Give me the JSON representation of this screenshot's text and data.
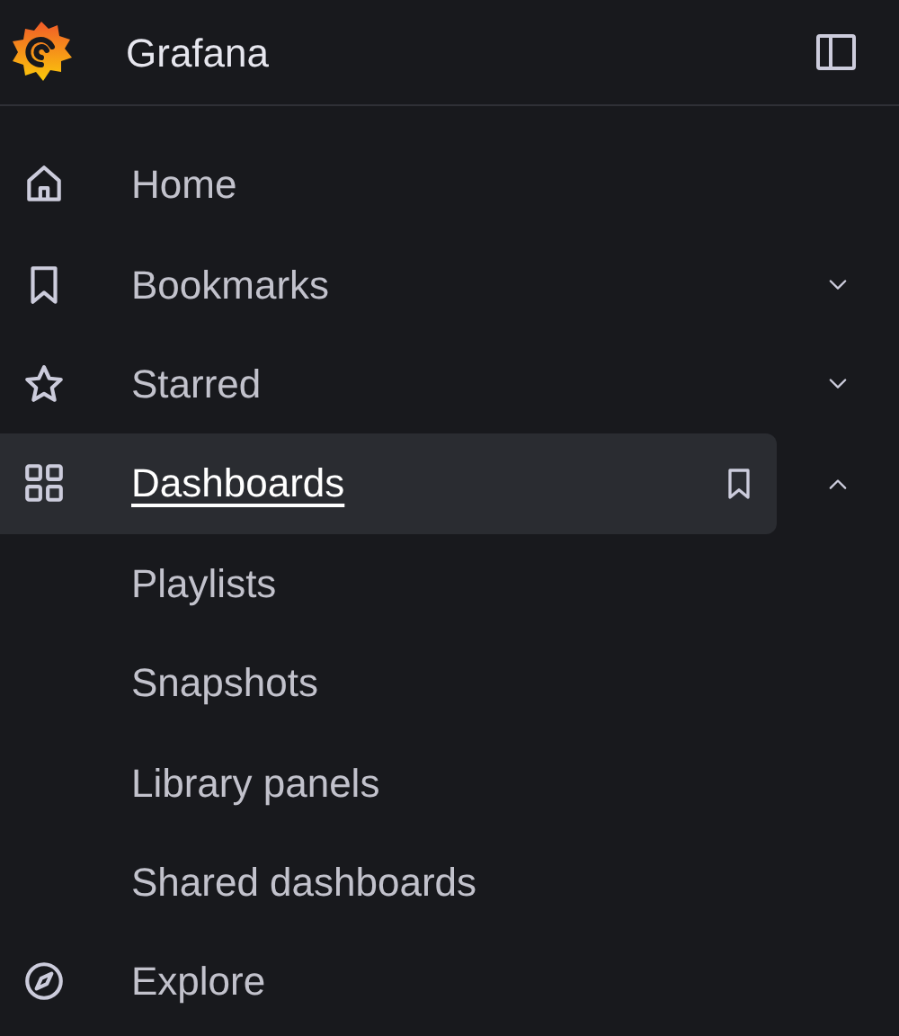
{
  "header": {
    "title": "Grafana"
  },
  "nav": [
    {
      "label": "Home",
      "selected": false
    },
    {
      "label": "Bookmarks",
      "selected": false,
      "expanded": false
    },
    {
      "label": "Starred",
      "selected": false,
      "expanded": false
    },
    {
      "label": "Dashboards",
      "selected": true,
      "expanded": true,
      "children": [
        {
          "label": "Playlists",
          "selected": false
        },
        {
          "label": "Snapshots",
          "selected": false
        },
        {
          "label": "Library panels",
          "selected": false
        },
        {
          "label": "Shared dashboards",
          "selected": false
        }
      ]
    },
    {
      "label": "Explore",
      "selected": false
    }
  ]
}
